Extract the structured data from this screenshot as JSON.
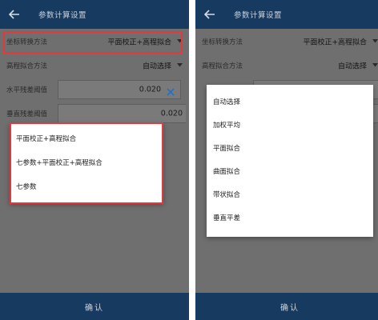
{
  "colors": {
    "appbar": "#173a61",
    "scrim": "#6f6f6f",
    "highlight": "#e0393e",
    "accent": "#1e73c8"
  },
  "left": {
    "header": {
      "title": "参数计算设置",
      "back_icon": "arrow-left-icon"
    },
    "coord_row": {
      "label": "坐标转换方法",
      "value": "平面校正+高程拟合"
    },
    "height_row": {
      "label": "高程拟合方法",
      "value": "自动选择"
    },
    "h_threshold": {
      "label": "水平残差阈值",
      "value": "0.020"
    },
    "v_threshold": {
      "label": "垂直残差阈值",
      "value": "0.020"
    },
    "menu_items": [
      "平面校正+高程拟合",
      "七参数+平面校正+高程拟合",
      "七参数"
    ],
    "footer": {
      "confirm_label": "确认"
    }
  },
  "right": {
    "header": {
      "title": "参数计算设置",
      "back_icon": "arrow-left-icon"
    },
    "coord_row": {
      "label": "坐标转换方法",
      "value": "平面校正+高程拟合"
    },
    "height_row": {
      "label": "高程拟合方法",
      "value": "自动选择"
    },
    "menu_items": [
      "自动选择",
      "加权平均",
      "平面拟合",
      "曲面拟合",
      "带状拟合",
      "垂直平差"
    ],
    "footer": {
      "confirm_label": "确认"
    }
  }
}
